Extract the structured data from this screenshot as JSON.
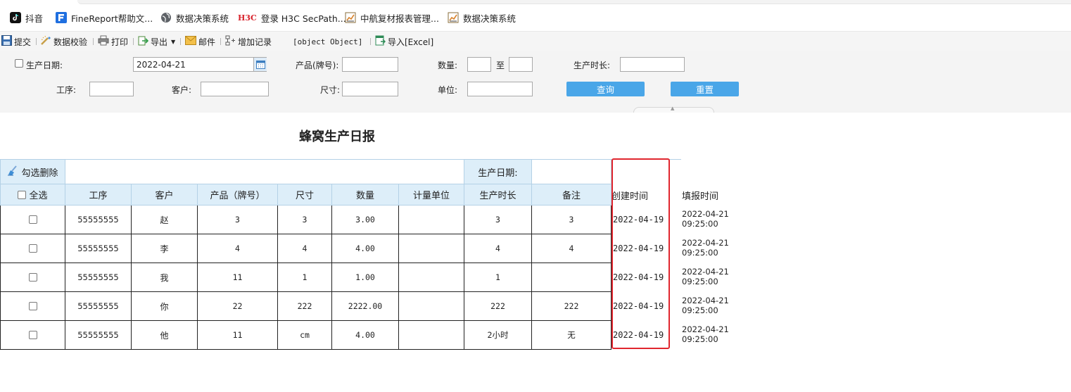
{
  "bookmarks": [
    {
      "label": "抖音",
      "icon": "douyin-icon"
    },
    {
      "label": "FineReport帮助文...",
      "icon": "finereport-icon"
    },
    {
      "label": "数据决策系统",
      "icon": "globe-icon"
    },
    {
      "label": "登录 H3C SecPath...",
      "icon": "h3c-icon",
      "icon_text": "H3C"
    },
    {
      "label": "中航复材报表管理...",
      "icon": "report-icon"
    },
    {
      "label": "数据决策系统",
      "icon": "report-icon"
    }
  ],
  "toolbar": {
    "submit": "提交",
    "validate": "数据校验",
    "print": "打印",
    "export": "导出",
    "email": "邮件",
    "add_record": "增加记录",
    "object_text": "[object Object]",
    "import_excel": "导入[Excel]"
  },
  "form": {
    "prod_date_label": "生产日期:",
    "prod_date_value": "2022-04-21",
    "product_label": "产品(牌号):",
    "qty_label": "数量:",
    "to_label": "至",
    "duration_label": "生产时长:",
    "process_label": "工序:",
    "customer_label": "客户:",
    "size_label": "尺寸:",
    "unit_label": "单位:",
    "query_button": "查询",
    "reset_button": "重置"
  },
  "report": {
    "title": "蜂窝生产日报",
    "delete_checked": "勾选删除",
    "prod_date_label": "生产日期:",
    "select_all": "全选",
    "columns": [
      "工序",
      "客户",
      "产品（牌号）",
      "尺寸",
      "数量",
      "计量单位",
      "生产时长",
      "备注"
    ],
    "extra_columns": [
      "创建时间",
      "填报时间"
    ],
    "rows": [
      {
        "process": "55555555",
        "customer": "赵",
        "product": "3",
        "size": "3",
        "qty": "3.00",
        "unit": "",
        "duration": "3",
        "note": "3",
        "created": "2022-04-19",
        "filled_date": "2022-04-21",
        "filled_time": "09:25:00"
      },
      {
        "process": "55555555",
        "customer": "李",
        "product": "4",
        "size": "4",
        "qty": "4.00",
        "unit": "",
        "duration": "4",
        "note": "4",
        "created": "2022-04-19",
        "filled_date": "2022-04-21",
        "filled_time": "09:25:00"
      },
      {
        "process": "55555555",
        "customer": "我",
        "product": "11",
        "size": "1",
        "qty": "1.00",
        "unit": "",
        "duration": "1",
        "note": "",
        "created": "2022-04-19",
        "filled_date": "2022-04-21",
        "filled_time": "09:25:00"
      },
      {
        "process": "55555555",
        "customer": "你",
        "product": "22",
        "size": "222",
        "qty": "2222.00",
        "unit": "",
        "duration": "222",
        "note": "222",
        "created": "2022-04-19",
        "filled_date": "2022-04-21",
        "filled_time": "09:25:00"
      },
      {
        "process": "55555555",
        "customer": "他",
        "product": "11",
        "size": "cm",
        "qty": "4.00",
        "unit": "",
        "duration": "2小时",
        "note": "无",
        "created": "2022-04-19",
        "filled_date": "2022-04-21",
        "filled_time": "09:25:00"
      }
    ]
  },
  "colors": {
    "accent": "#4aa6e8",
    "header_bg": "#ddeef9",
    "highlight": "#e0262e"
  }
}
